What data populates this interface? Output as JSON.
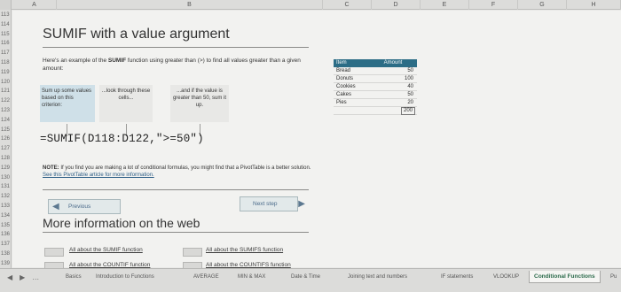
{
  "columns": [
    "A",
    "B",
    "C",
    "D",
    "E",
    "F",
    "G",
    "H"
  ],
  "rows": [
    "113",
    "114",
    "115",
    "116",
    "117",
    "118",
    "119",
    "120",
    "121",
    "122",
    "123",
    "124",
    "125",
    "126",
    "127",
    "128",
    "129",
    "130",
    "131",
    "132",
    "133",
    "134",
    "135",
    "136",
    "137",
    "138",
    "139"
  ],
  "title": "SUMIF with a value argument",
  "intro": {
    "pre": "Here's an example of the ",
    "fn": "SUMIF",
    "post": " function using greater than (>) to find all values greater than a given amount:"
  },
  "callouts": [
    "Sum up some values based on this criterion:",
    "...look through these cells...",
    "...and if the value is greater than 50, sum it up."
  ],
  "formula": "=SUMIF(D118:D122,\">=50\")",
  "note": {
    "label": "NOTE:",
    "text": " If you find you are making a lot of conditional formulas, you might find that a PivotTable is a better solution. ",
    "link": "See this PivotTable article for more information."
  },
  "buttons": {
    "previous": "Previous",
    "next": "Next step"
  },
  "more_info_title": "More information on the web",
  "links": {
    "sumif": "All about the SUMIF function",
    "sumifs": "All about the SUMIFS function",
    "countif": "All about the COUNTIF function",
    "countifs": "All about the COUNTIFS function"
  },
  "table": {
    "headers": [
      "Item",
      "Amount"
    ],
    "rows": [
      {
        "item": "Bread",
        "amount": "50"
      },
      {
        "item": "Donuts",
        "amount": "100"
      },
      {
        "item": "Cookies",
        "amount": "40"
      },
      {
        "item": "Cakes",
        "amount": "50"
      },
      {
        "item": "Pies",
        "amount": "20"
      }
    ],
    "total": "200"
  },
  "tabs": [
    "Basics",
    "Introduction to Functions",
    "AVERAGE",
    "MIN & MAX",
    "Date & Time",
    "Joining text and numbers",
    "IF statements",
    "VLOOKUP",
    "Conditional Functions",
    "Pu"
  ],
  "active_tab": "Conditional Functions",
  "colors": {
    "accent": "#2c6d86",
    "active_tab_text": "#2a6a4a",
    "callout_bg": "#cfe0e8"
  }
}
